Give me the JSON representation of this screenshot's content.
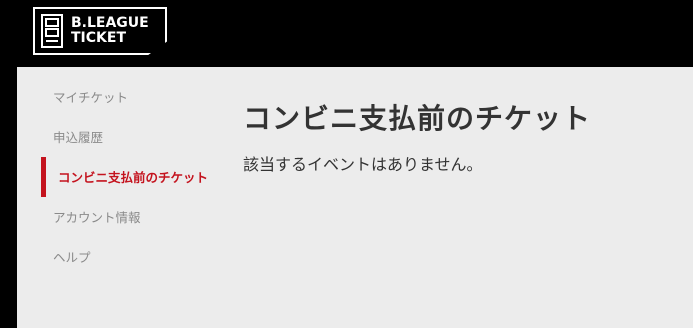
{
  "brand": {
    "line1": "B.LEAGUE",
    "line2": "TICKET"
  },
  "sidebar": {
    "items": [
      {
        "label": "マイチケット"
      },
      {
        "label": "申込履歴"
      },
      {
        "label": "コンビニ支払前のチケット",
        "active": true
      },
      {
        "label": "アカウント情報"
      },
      {
        "label": "ヘルプ"
      }
    ]
  },
  "main": {
    "title": "コンビニ支払前のチケット",
    "message": "該当するイベントはありません。"
  },
  "colors": {
    "accent": "#c4131e",
    "header_bg": "#000000",
    "content_bg": "#ececec",
    "text": "#333333",
    "nav_text": "#8a8a8a"
  }
}
